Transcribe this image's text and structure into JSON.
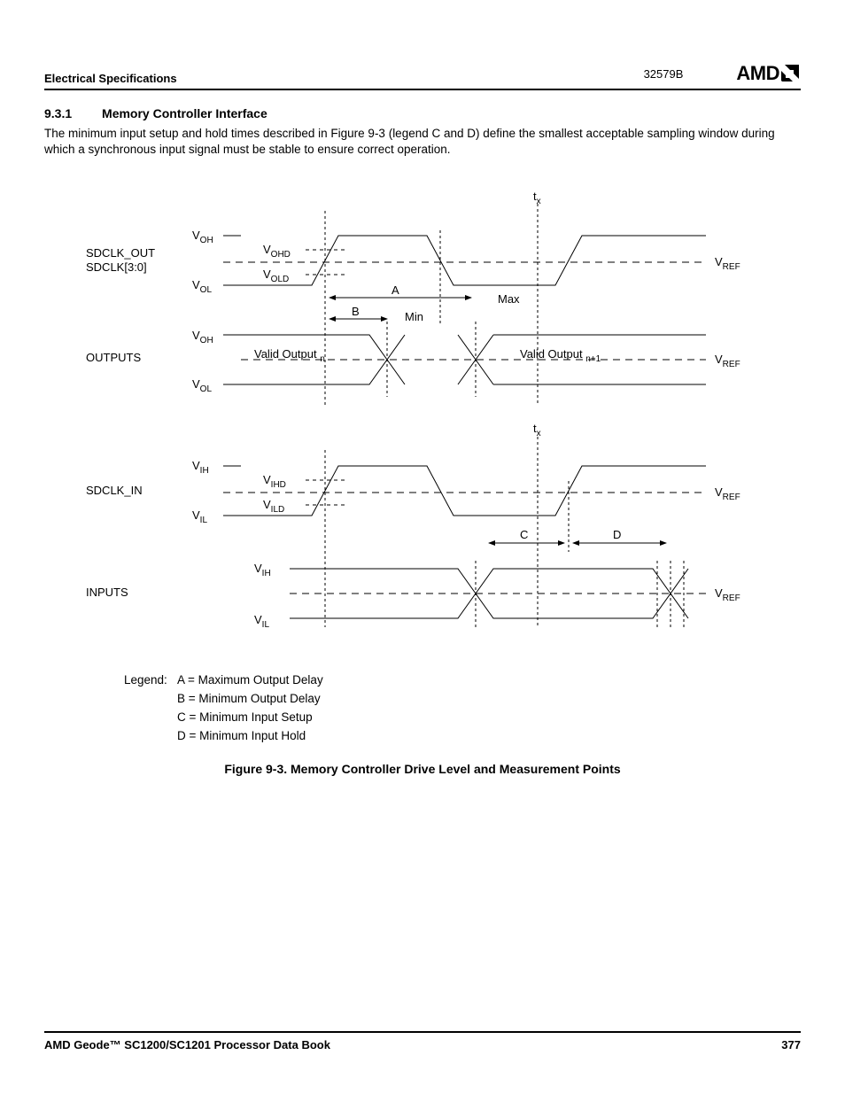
{
  "header": {
    "section_label": "Electrical Specifications",
    "doc_code": "32579B",
    "logo_text": "AMD"
  },
  "section": {
    "number": "9.3.1",
    "title": "Memory Controller Interface"
  },
  "body_text": "The minimum input setup and hold times described in Figure 9-3 (legend C and D) define the smallest acceptable sampling window during which a synchronous input signal must be stable to ensure correct operation.",
  "figure": {
    "tx_label": "t",
    "tx_sub": "x",
    "signals": {
      "sdclk_out_1": "SDCLK_OUT",
      "sdclk_out_2": "SDCLK[3:0]",
      "outputs": "OUTPUTS",
      "sdclk_in": "SDCLK_IN",
      "inputs": "INPUTS"
    },
    "levels": {
      "voh": "V",
      "voh_sub": "OH",
      "vol": "V",
      "vol_sub": "OL",
      "vih": "V",
      "vih_sub": "IH",
      "vil": "V",
      "vil_sub": "IL",
      "vref": "V",
      "vref_sub": "REF",
      "vohd": "V",
      "vohd_sub": "OHD",
      "vold": "V",
      "vold_sub": "OLD",
      "vihd": "V",
      "vihd_sub": "IHD",
      "vild": "V",
      "vild_sub": "ILD"
    },
    "markers": {
      "a": "A",
      "b": "B",
      "min": "Min",
      "max": "Max",
      "c": "C",
      "d": "D",
      "valid_out": "Valid Output ",
      "valid_out_sub_n": "n",
      "valid_out_sub_n1": "n+1"
    },
    "legend_label": "Legend:",
    "legend": {
      "a": "A = Maximum Output Delay",
      "b": "B = Minimum Output Delay",
      "c": "C = Minimum Input Setup",
      "d": "D = Minimum Input Hold"
    },
    "caption": "Figure 9-3.  Memory Controller Drive Level and Measurement Points"
  },
  "footer": {
    "book_title": "AMD Geode™ SC1200/SC1201 Processor Data Book",
    "page": "377"
  }
}
